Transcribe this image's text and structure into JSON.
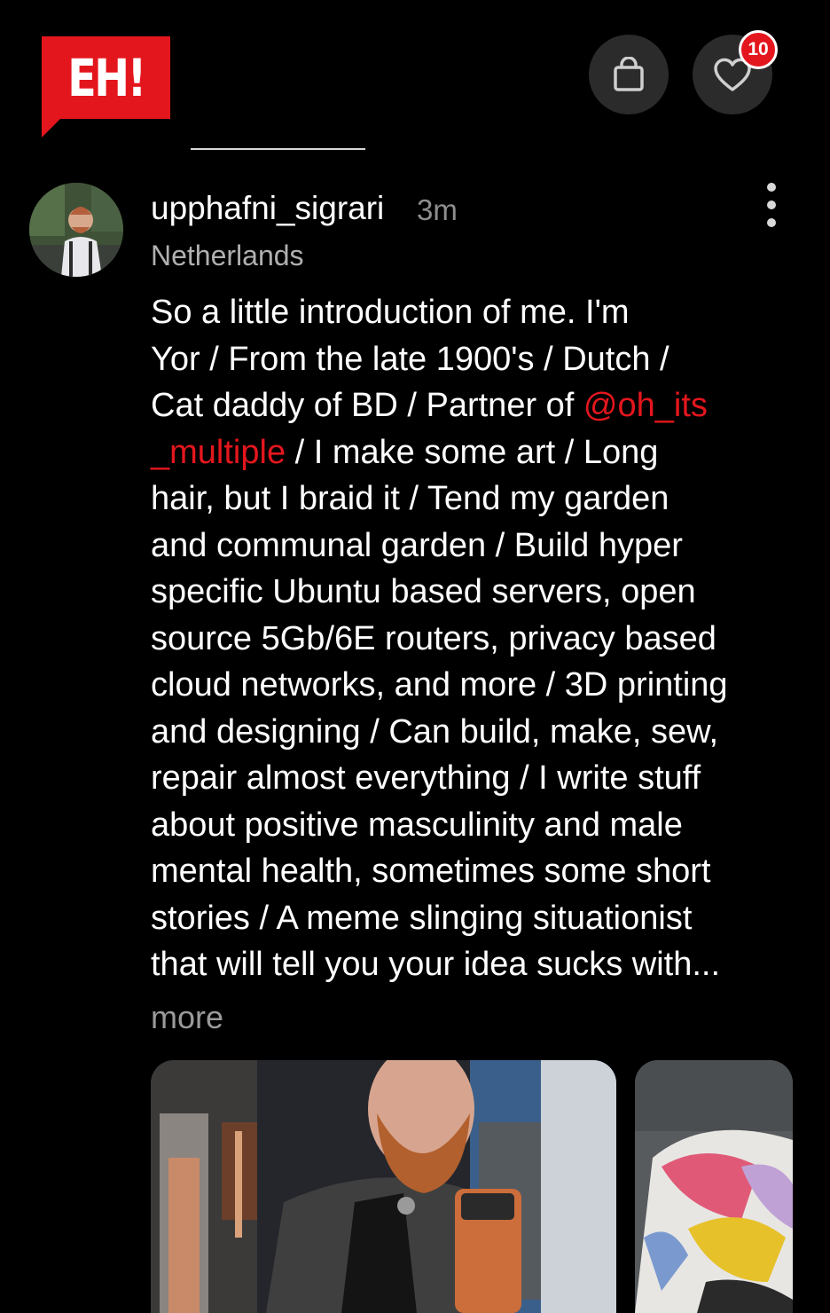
{
  "header": {
    "logo_text": "EH!",
    "bag_icon": "shopping-bag-icon",
    "heart_icon": "heart-icon",
    "notification_count": "10",
    "brand_color": "#e4161d"
  },
  "post": {
    "username": "upphafni_sigrari",
    "time": "3m",
    "location": "Netherlands",
    "lines": [
      "So a little introduction of me. I'm",
      "Yor / From the late 1900's / Dutch /",
      "Cat daddy of BD / Partner of ",
      "@oh_its",
      "_multiple",
      " / I make some art / Long",
      "hair, but I braid it / Tend my garden",
      "and communal garden / Build hyper",
      "specific Ubuntu based servers, open",
      "source 5Gb/6E routers, privacy based",
      "cloud networks, and more / 3D printing",
      "and designing / Can build, make, sew,",
      "repair almost everything / I write stuff",
      "about positive masculinity and male",
      "mental health, sometimes some short",
      "stories / A meme slinging situationist",
      "that will tell you your idea sucks with..."
    ],
    "more_label": "more"
  }
}
